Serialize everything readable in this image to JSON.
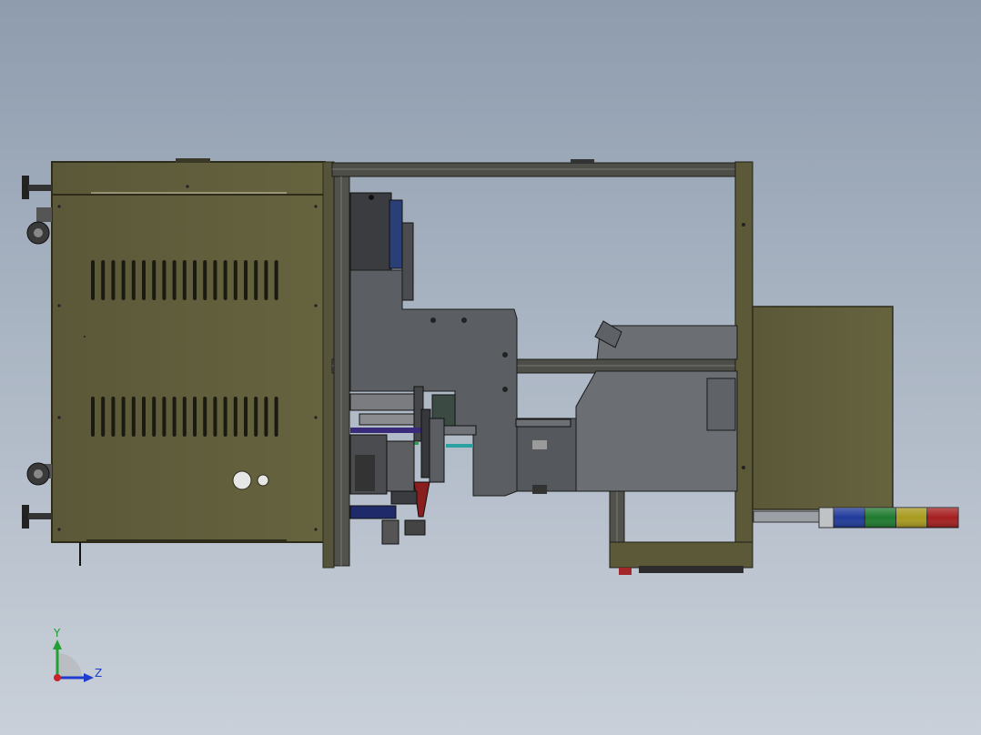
{
  "viewport": {
    "background_top": "#8e9cae",
    "background_bottom": "#c9d0d9"
  },
  "colors": {
    "cabinet_olive": "#5e5b3a",
    "cabinet_edge": "#2d2b1a",
    "frame_gray": "#6a6a62",
    "machine_gray": "#5a5d62",
    "stack_light": [
      "#b9bcbf",
      "#1f3a9a",
      "#1e7a2e",
      "#a89a1e",
      "#a51e1e"
    ]
  },
  "triad": {
    "y_label": "Y",
    "z_label": "Z",
    "x_color": "#c8242a",
    "y_color": "#23a033",
    "z_color": "#1f3ccf"
  },
  "icons": [
    "coordinate-triad-icon",
    "caster-wheel-icon",
    "leveling-foot-icon"
  ]
}
